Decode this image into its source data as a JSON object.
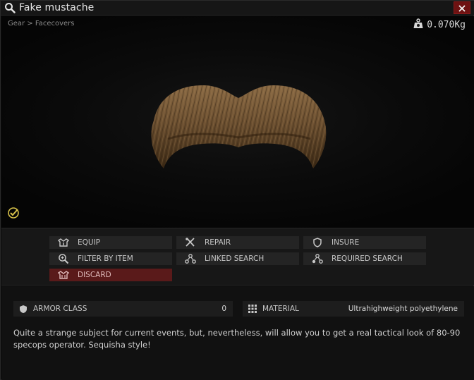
{
  "window": {
    "title": "Fake mustache",
    "close_icon": "close-icon"
  },
  "preview": {
    "breadcrumb": "Gear > Facecovers",
    "weight": "0.070Kg",
    "item_icon": "mustache-image",
    "examined_icon": "checkmark-circle-icon"
  },
  "actions": {
    "equip": "EQUIP",
    "repair": "REPAIR",
    "insure": "INSURE",
    "filter_by_item": "FILTER BY ITEM",
    "linked_search": "LINKED SEARCH",
    "required_search": "REQUIRED SEARCH",
    "discard": "DISCARD"
  },
  "attributes": {
    "armor_class": {
      "label": "ARMOR CLASS",
      "value": "0"
    },
    "material": {
      "label": "MATERIAL",
      "value": "Ultrahighweight polyethylene"
    }
  },
  "description": "Quite a strange subject for current events, but, nevertheless, will allow you to get a real tactical look of 80-90 specops operator. Sequisha style!",
  "colors": {
    "discard_bg": "#5a1a1a",
    "close_bg": "#6e1212",
    "examined_accent": "#d8c24a"
  }
}
